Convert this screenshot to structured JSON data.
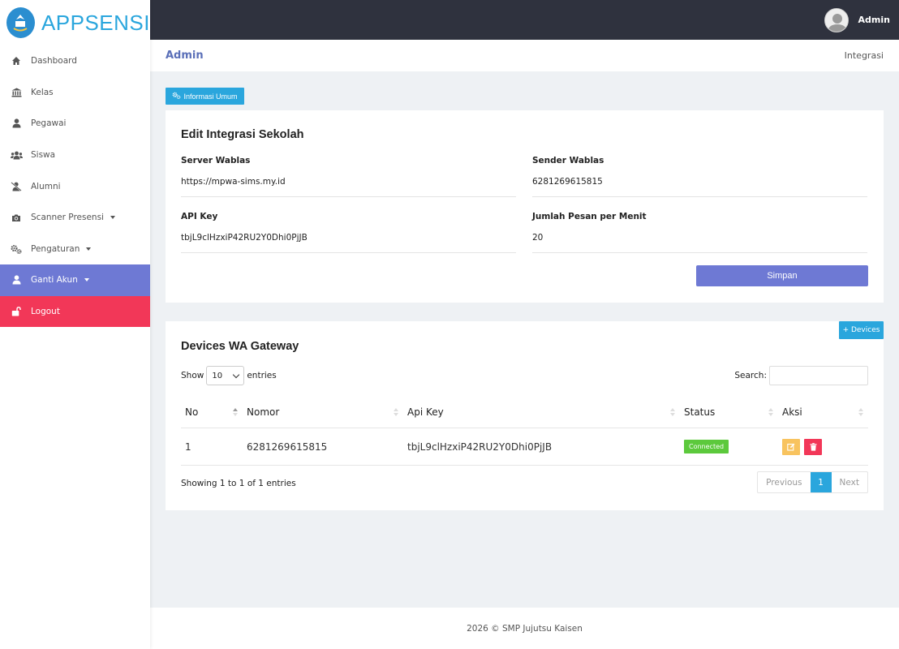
{
  "brand": {
    "name": "APPSENSI",
    "logo_icon": "school-emblem-icon"
  },
  "sidebar": {
    "items": [
      {
        "label": "Dashboard",
        "icon": "home-icon"
      },
      {
        "label": "Kelas",
        "icon": "bank-icon"
      },
      {
        "label": "Pegawai",
        "icon": "user-icon"
      },
      {
        "label": "Siswa",
        "icon": "users-icon"
      },
      {
        "label": "Alumni",
        "icon": "user-slash-icon"
      },
      {
        "label": "Scanner Presensi",
        "icon": "camera-icon",
        "dropdown": true
      },
      {
        "label": "Pengaturan",
        "icon": "gears-icon",
        "dropdown": true
      },
      {
        "label": "Ganti Akun",
        "icon": "user-icon",
        "dropdown": true,
        "active": true
      },
      {
        "label": "Logout",
        "icon": "unlock-icon"
      }
    ]
  },
  "topbar": {
    "user_name": "Admin"
  },
  "breadcrumb": {
    "title": "Admin",
    "current": "Integrasi"
  },
  "info_button": {
    "label": "Informasi Umum"
  },
  "integration_form": {
    "title": "Edit Integrasi Sekolah",
    "server_label": "Server Wablas",
    "server_value": "https://mpwa-sims.my.id",
    "sender_label": "Sender Wablas",
    "sender_value": "6281269615815",
    "apikey_label": "API Key",
    "apikey_value": "tbjL9clHzxiP42RU2Y0Dhi0PjJB",
    "rate_label": "Jumlah Pesan per Menit",
    "rate_value": "20",
    "submit_label": "Simpan"
  },
  "devices": {
    "title": "Devices WA Gateway",
    "add_label": "+ Devices",
    "show_label": "Show",
    "entries_value": "10",
    "entries_label": "entries",
    "search_label": "Search:",
    "columns": [
      "No",
      "Nomor",
      "Api Key",
      "Status",
      "Aksi"
    ],
    "rows": [
      {
        "no": "1",
        "nomor": "6281269615815",
        "api_key": "tbjL9clHzxiP42RU2Y0Dhi0PjJB",
        "status": "Connected"
      }
    ],
    "showing_text": "Showing 1 to 1 of 1 entries",
    "pagination": {
      "prev": "Previous",
      "current": "1",
      "next": "Next"
    }
  },
  "footer": {
    "text": "2026 © SMP Jujutsu Kaisen"
  },
  "colors": {
    "accent": "#2aa6dd",
    "primary": "#6e79d4",
    "danger": "#f23758",
    "warning": "#f8c35f",
    "success": "#5cc93c",
    "topbar": "#2f323e"
  }
}
